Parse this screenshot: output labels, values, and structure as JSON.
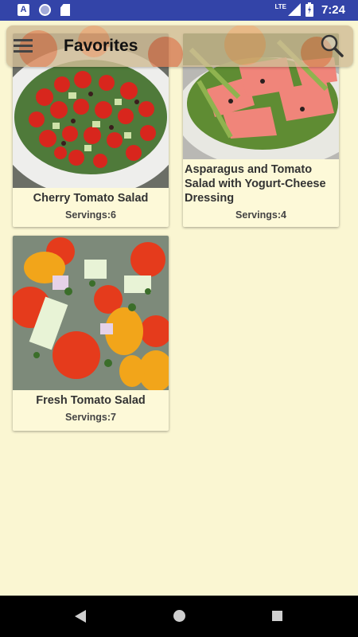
{
  "status_bar": {
    "time": "7:24",
    "network": "LTE",
    "icons": [
      "a-icon",
      "circle-icon",
      "sd-card-icon",
      "signal-icon",
      "battery-icon"
    ]
  },
  "app_bar": {
    "title": "Favorites",
    "menu_icon": "hamburger-menu-icon",
    "search_icon": "search-icon"
  },
  "recipes": [
    {
      "title": "Cherry Tomato Salad",
      "servings": "Servings:6",
      "image": "cherry-tomato-salad-photo"
    },
    {
      "title": "Asparagus and Tomato Salad with Yogurt-Cheese Dressing",
      "servings": "Servings:4",
      "image": "asparagus-tomato-salad-photo"
    },
    {
      "title": "Fresh Tomato Salad",
      "servings": "Servings:7",
      "image": "fresh-tomato-salad-photo"
    }
  ],
  "nav_bar": {
    "icons": [
      "back-icon",
      "home-icon",
      "recents-icon"
    ]
  },
  "colors": {
    "status_bar": "#3344a8",
    "background": "#faf6d2",
    "card": "#fdf9d8",
    "text": "#333333"
  }
}
